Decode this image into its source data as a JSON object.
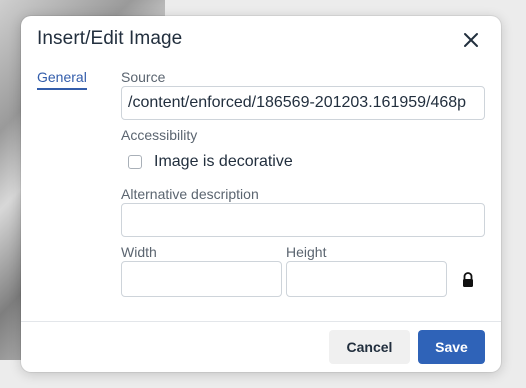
{
  "dialog": {
    "title": "Insert/Edit Image",
    "close_icon": "close-icon"
  },
  "nav": {
    "active_tab": "General"
  },
  "form": {
    "source_label": "Source",
    "source_value": "/content/enforced/186569-201203.161959/468p",
    "accessibility_label": "Accessibility",
    "decorative_label": "Image is decorative",
    "decorative_checked": false,
    "alt_label": "Alternative description",
    "alt_value": "",
    "width_label": "Width",
    "width_value": "",
    "height_label": "Height",
    "height_value": "",
    "lock_icon": "lock-icon"
  },
  "footer": {
    "cancel_label": "Cancel",
    "save_label": "Save"
  },
  "colors": {
    "primary": "#2f63b8",
    "link": "#335dab",
    "text": "#222f3e"
  }
}
